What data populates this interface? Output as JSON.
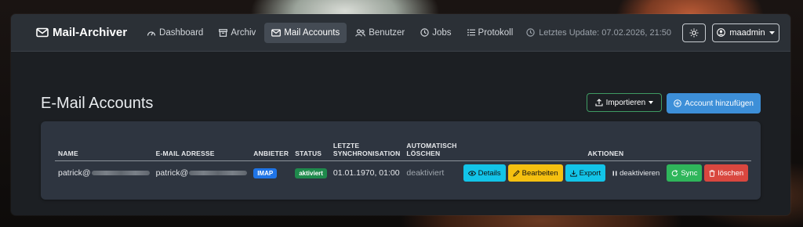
{
  "nav": {
    "brand": "Mail-Archiver",
    "items": [
      {
        "label": "Dashboard",
        "icon": "dashboard-icon"
      },
      {
        "label": "Archiv",
        "icon": "archive-icon"
      },
      {
        "label": "Mail Accounts",
        "icon": "mail-accounts-icon",
        "active": true
      },
      {
        "label": "Benutzer",
        "icon": "users-icon"
      },
      {
        "label": "Jobs",
        "icon": "clock-icon"
      },
      {
        "label": "Protokoll",
        "icon": "list-icon"
      }
    ],
    "last_update": "Letztes Update: 07.02.2026, 21:50",
    "user": "maadmin"
  },
  "page": {
    "title": "E-Mail Accounts",
    "import_label": "Importieren",
    "add_label": "Account hinzufügen"
  },
  "table": {
    "headers": [
      "NAME",
      "E-MAIL ADRESSE",
      "ANBIETER",
      "STATUS",
      "LETZTE SYNCHRONISATION",
      "AUTOMATISCH LÖSCHEN",
      "AKTIONEN"
    ],
    "rows": [
      {
        "name": "patrick@",
        "email": "patrick@",
        "provider": "IMAP",
        "status": "aktiviert",
        "last_sync": "01.01.1970, 01:00",
        "auto_delete": "deaktiviert"
      }
    ],
    "actions": {
      "details": "Details",
      "edit": "Bearbeiten",
      "export": "Export",
      "deactivate": "deaktivieren",
      "sync": "Sync",
      "delete": "löschen"
    }
  },
  "colors": {
    "accent": "#3d8fd8",
    "info": "#12c4e8",
    "warning": "#f5c010",
    "success": "#2fb65b",
    "danger": "#d9473f",
    "imap": "#1f74e6"
  }
}
